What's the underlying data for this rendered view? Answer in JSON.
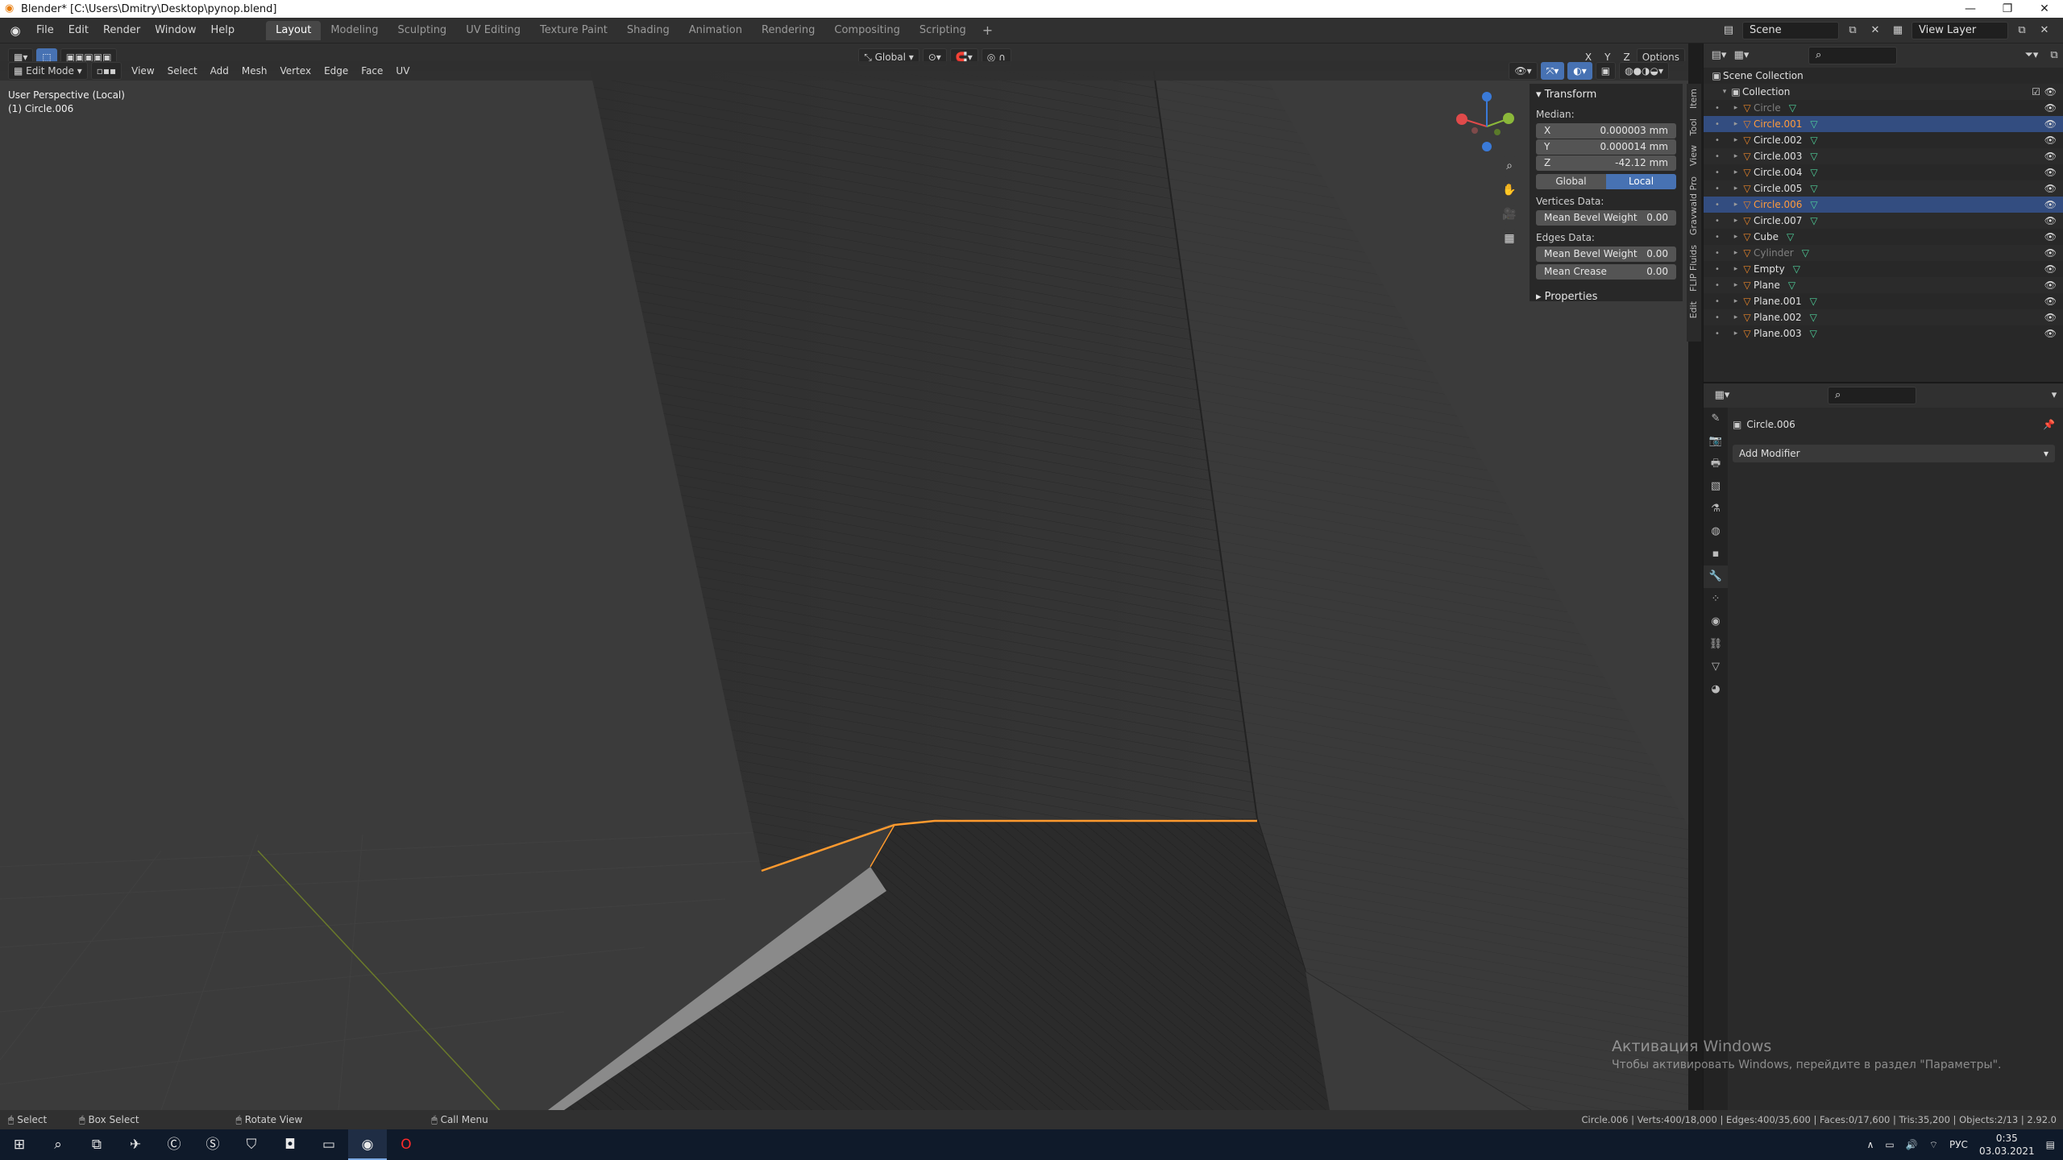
{
  "titlebar": {
    "title": "Blender* [C:\\Users\\Dmitry\\Desktop\\pynop.blend]"
  },
  "menu": {
    "file": "File",
    "edit": "Edit",
    "render": "Render",
    "window": "Window",
    "help": "Help"
  },
  "workspaces": [
    "Layout",
    "Modeling",
    "Sculpting",
    "UV Editing",
    "Texture Paint",
    "Shading",
    "Animation",
    "Rendering",
    "Compositing",
    "Scripting"
  ],
  "scene": {
    "scene_name": "Scene",
    "view_layer": "View Layer"
  },
  "viewport_header": {
    "mode": "Edit Mode",
    "menus": [
      "View",
      "Select",
      "Add",
      "Mesh",
      "Vertex",
      "Edge",
      "Face",
      "UV"
    ],
    "orientation": "Global",
    "options": "Options",
    "axis_x": "X",
    "axis_y": "Y",
    "axis_z": "Z"
  },
  "viewport": {
    "perspective": "User Perspective (Local)",
    "object": "(1) Circle.006"
  },
  "npanel": {
    "title": "Transform",
    "median_label": "Median:",
    "x_label": "X",
    "x_value": "0.000003 mm",
    "y_label": "Y",
    "y_value": "0.000014 mm",
    "z_label": "Z",
    "z_value": "-42.12 mm",
    "global": "Global",
    "local": "Local",
    "vertices_label": "Vertices Data:",
    "mean_bevel_label": "Mean Bevel Weight",
    "mean_bevel_value": "0.00",
    "edges_label": "Edges Data:",
    "edge_bevel_label": "Mean Bevel Weight",
    "edge_bevel_value": "0.00",
    "crease_label": "Mean Crease",
    "crease_value": "0.00",
    "properties": "Properties",
    "tabs": [
      "Item",
      "Tool",
      "View",
      "Gravwald Pro",
      "FLIP Fluids",
      "Edit"
    ]
  },
  "outliner": {
    "scene_collection": "Scene Collection",
    "collection": "Collection",
    "items": [
      {
        "name": "Circle",
        "dim": true
      },
      {
        "name": "Circle.001",
        "sel": true
      },
      {
        "name": "Circle.002"
      },
      {
        "name": "Circle.003"
      },
      {
        "name": "Circle.004"
      },
      {
        "name": "Circle.005"
      },
      {
        "name": "Circle.006",
        "sel": true
      },
      {
        "name": "Circle.007"
      },
      {
        "name": "Cube"
      },
      {
        "name": "Cylinder",
        "dim": true
      },
      {
        "name": "Empty"
      },
      {
        "name": "Plane"
      },
      {
        "name": "Plane.001"
      },
      {
        "name": "Plane.002"
      },
      {
        "name": "Plane.003"
      }
    ]
  },
  "properties": {
    "object_name": "Circle.006",
    "add_modifier": "Add Modifier"
  },
  "watermark": {
    "line1": "Активация Windows",
    "line2": "Чтобы активировать Windows, перейдите в раздел \"Параметры\"."
  },
  "statusbar": {
    "select": "Select",
    "box_select": "Box Select",
    "rotate_view": "Rotate View",
    "call_menu": "Call Menu",
    "stats": "Circle.006 | Verts:400/18,000 | Edges:400/35,600 | Faces:0/17,600 | Tris:35,200 | Objects:2/13 | 2.92.0"
  },
  "taskbar": {
    "lang": "РУС",
    "time": "0:35",
    "date": "03.03.2021"
  },
  "colors": {
    "accent": "#4772b3",
    "selection": "#334d80",
    "edge_highlight": "#ff9a2e",
    "mesh": "#4fd19b"
  }
}
